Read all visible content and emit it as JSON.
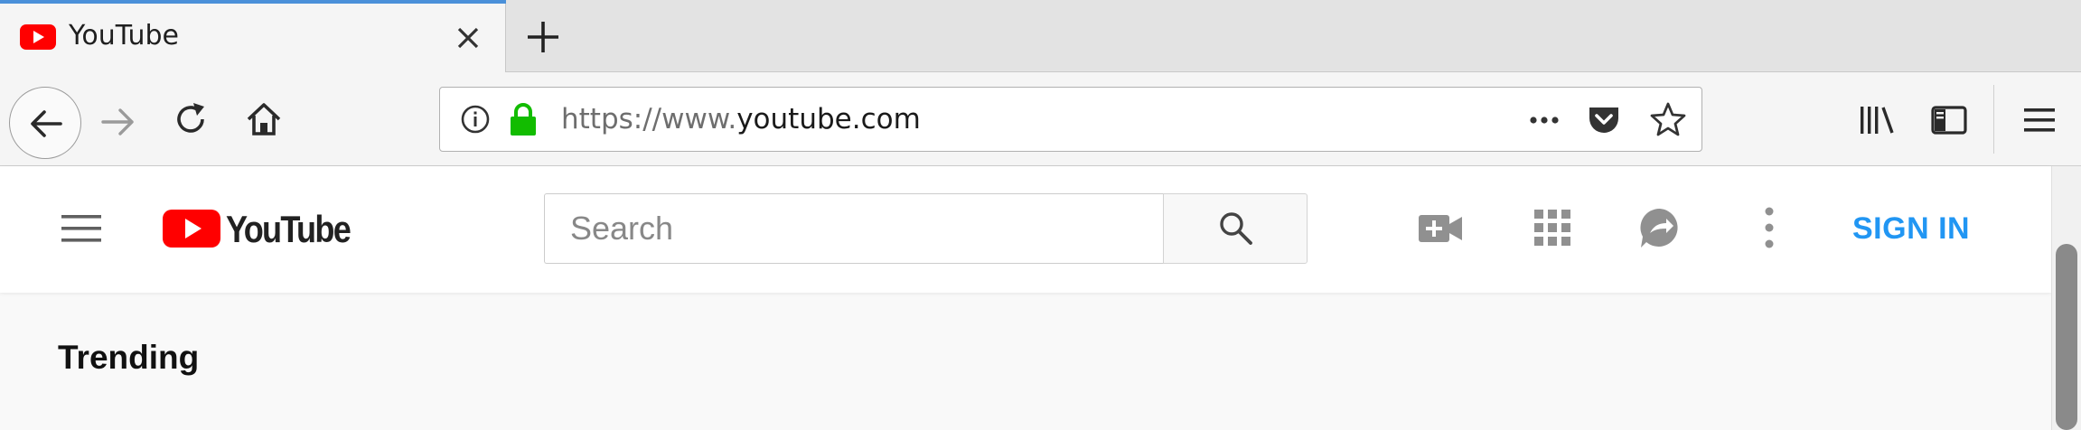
{
  "browser": {
    "tab": {
      "title": "YouTube",
      "favicon": "youtube-favicon-icon"
    },
    "toolbar": {
      "url_prefix": "https://www.",
      "url_domain": "youtube.com",
      "icons": [
        "back-arrow-icon",
        "forward-arrow-icon",
        "reload-icon",
        "home-icon",
        "site-info-icon",
        "lock-icon",
        "page-actions-dots-icon",
        "pocket-icon",
        "bookmark-star-icon",
        "library-icon",
        "sidebar-icon",
        "hamburger-menu-icon"
      ]
    }
  },
  "youtube": {
    "logo_text": "YouTube",
    "search": {
      "placeholder": "Search"
    },
    "signin_label": "SIGN IN",
    "section_title": "Trending"
  },
  "colors": {
    "youtube_red": "#ff0000",
    "signin_blue": "#2196f3",
    "secure_lock_green": "#12bc00"
  }
}
